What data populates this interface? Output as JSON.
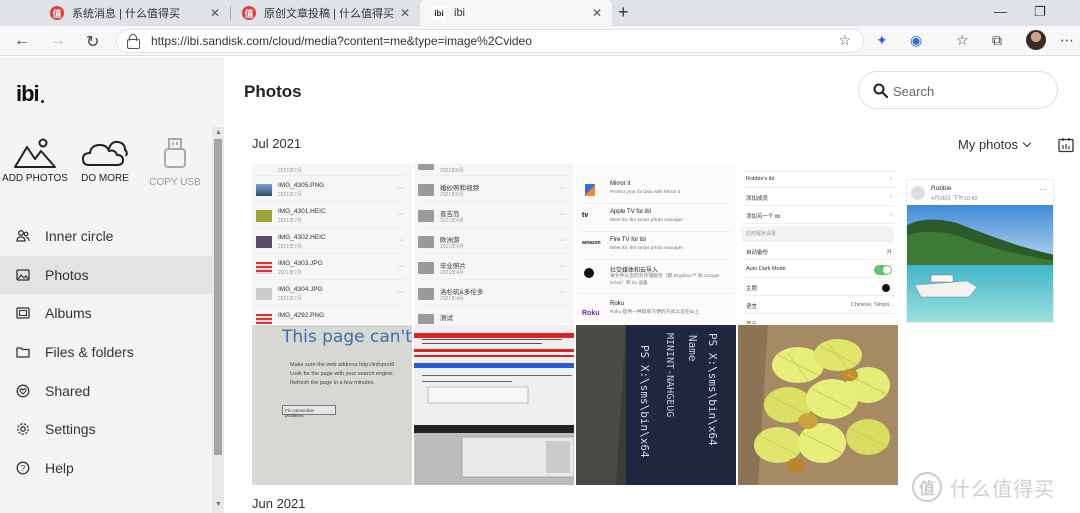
{
  "browser": {
    "tabs": [
      {
        "title": "系统消息 | 什么值得买",
        "favicon": "值"
      },
      {
        "title": "原创文章投稿 | 什么值得买",
        "favicon": "值"
      },
      {
        "title": "ibi",
        "favicon": "ibi"
      }
    ],
    "url": "https://ibi.sandisk.com/cloud/media?content=me&type=image%2Cvideo"
  },
  "sidebar": {
    "logo": "ibi",
    "actions": [
      {
        "label": "ADD PHOTOS",
        "icon": "mountains-icon"
      },
      {
        "label": "DO MORE",
        "icon": "clouds-icon"
      },
      {
        "label": "COPY USB",
        "icon": "usb-icon",
        "disabled": true
      }
    ],
    "items": [
      {
        "label": "Inner circle",
        "icon": "people-icon"
      },
      {
        "label": "Photos",
        "icon": "image-icon"
      },
      {
        "label": "Albums",
        "icon": "album-icon"
      },
      {
        "label": "Files & folders",
        "icon": "folder-icon"
      },
      {
        "label": "Shared",
        "icon": "shared-icon"
      },
      {
        "label": "Settings",
        "icon": "gear-icon"
      },
      {
        "label": "Help",
        "icon": "help-icon"
      }
    ]
  },
  "main": {
    "title": "Photos",
    "search_placeholder": "Search",
    "filter_label": "My photos",
    "months": [
      "Jul 2021",
      "Jun 2021"
    ]
  },
  "thumbs": {
    "t1": {
      "files": [
        {
          "name": "",
          "date": "2021年7月"
        },
        {
          "name": "IMG_4305.PNG",
          "date": "2021年7月"
        },
        {
          "name": "IMG_4301.HEIC",
          "date": "2021年7月"
        },
        {
          "name": "IMG_4302.HEIC",
          "date": "2021年7月"
        },
        {
          "name": "IMG_4303.JPG",
          "date": "2021年7月"
        },
        {
          "name": "IMG_4304.JPG",
          "date": "2021年7月"
        },
        {
          "name": "IMG_4292.PNG",
          "date": ""
        }
      ]
    },
    "t2": {
      "files": [
        {
          "name": "",
          "date": "2021年6月"
        },
        {
          "name": "婚纱照和视频",
          "date": "2021年6月"
        },
        {
          "name": "普吉岛",
          "date": "2021年4月"
        },
        {
          "name": "欧洲游",
          "date": "2021年4月"
        },
        {
          "name": "毕业照片",
          "date": "2021年4月"
        },
        {
          "name": "洛杉矶&多伦多",
          "date": "2021年4月"
        },
        {
          "name": "测试",
          "date": ""
        }
      ]
    },
    "t3": {
      "apps": [
        {
          "name": "Mirror it",
          "desc": "Protect your ibi data with Mirror It"
        },
        {
          "name": "Apple TV for ibi",
          "desc": "Meet ibi, the smart photo manager"
        },
        {
          "name": "Fire TV for ibi",
          "desc": "Meet ibi, the smart photo manager"
        },
        {
          "name": "社交媒体和云导入",
          "desc": "将文件从您的云存储服务（即 Dropbox™ 和 Google Drive）和 ibi 设备"
        },
        {
          "name": "Roku",
          "desc": "Roku 提供一种简单方便的方式以及在ibi上"
        }
      ],
      "icon_labels": [
        "tv",
        "amazon",
        "Roku"
      ]
    },
    "t4": {
      "rows": [
        {
          "name": "Robbie's ibi",
          "value": ""
        },
        {
          "name": "添加成员",
          "value": ""
        },
        {
          "name": "添加另一个 ibi",
          "value": ""
        },
        {
          "name": "应用程序设置",
          "value": ""
        },
        {
          "name": "自动备份",
          "value": "开"
        },
        {
          "name": "Auto Dark Mode",
          "value": ""
        },
        {
          "name": "主题",
          "value": ""
        },
        {
          "name": "语言",
          "value": "Chinese, Simpli.."
        },
        {
          "name": "显示",
          "value": ""
        }
      ]
    },
    "t5": {
      "author": "Robbie",
      "date": "4月26日 下午10:42"
    },
    "t6": {
      "heading": "This page can't b",
      "bullets": [
        "Make sure the web address http://infoport8",
        "Look for the page with your search engine.",
        "Refresh the page in a few minutes."
      ],
      "button": "Fix connection problems"
    },
    "t8": {
      "lines": [
        "PS X:\\sms\\bin\\x64",
        "MININT-NAHGEUG",
        "Name"
      ]
    }
  },
  "watermark": {
    "symbol": "值",
    "text": "什么值得买"
  }
}
